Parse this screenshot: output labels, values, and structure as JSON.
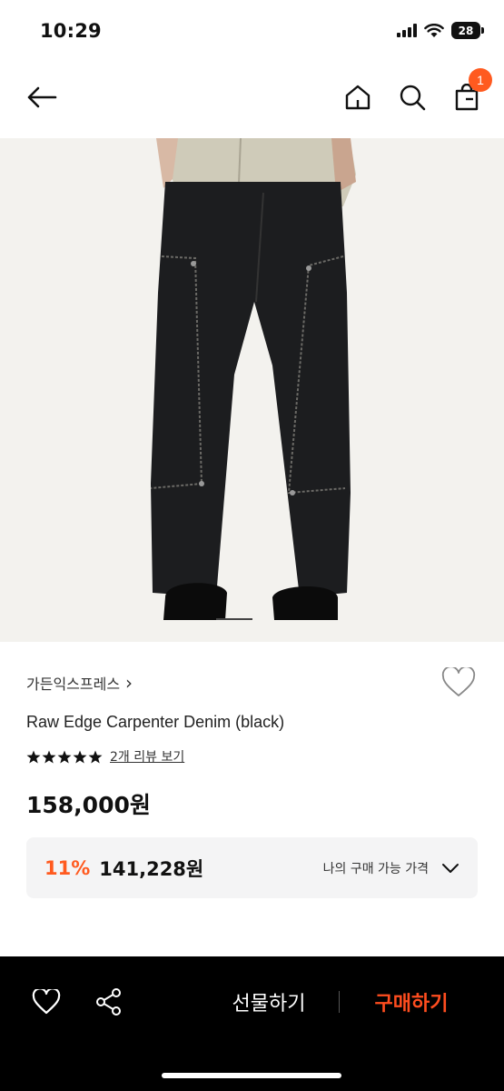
{
  "status_bar": {
    "time": "10:29",
    "battery": "28"
  },
  "nav": {
    "back_icon": "arrow-left-icon",
    "home_icon": "home-icon",
    "search_icon": "search-icon",
    "cart_icon": "shopping-bag-icon",
    "cart_count": "1"
  },
  "product": {
    "brand": "가든익스프레스",
    "brand_chevron": "›",
    "name": "Raw Edge Carpenter Denim (black)",
    "rating_stars": 5,
    "review_link": "2개 리뷰 보기",
    "price": "158,000원",
    "discount": {
      "percent": "11%",
      "price": "141,228원",
      "label": "나의 구매 가능 가격"
    }
  },
  "bottom_bar": {
    "gift_label": "선물하기",
    "buy_label": "구매하기"
  },
  "colors": {
    "accent": "#ff5a1f",
    "buy": "#ff4d1f",
    "bar": "#000000",
    "panel": "#f4f4f5"
  }
}
